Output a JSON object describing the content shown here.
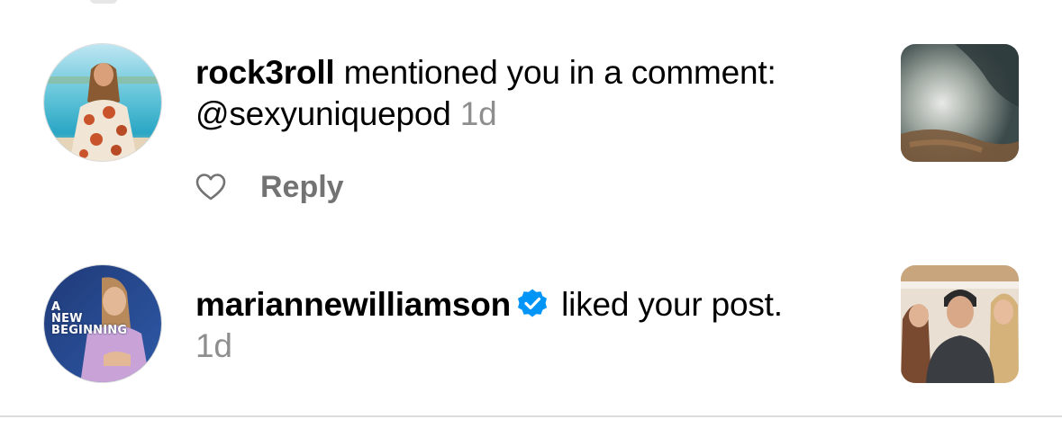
{
  "notifications": [
    {
      "username": "rock3roll",
      "text": " mentioned you in a comment: @sexyuniquepod",
      "time": "1d",
      "like_icon": "heart-outline-icon",
      "reply_label": "Reply"
    },
    {
      "username": "mariannewilliamson",
      "verified_icon": "verified-badge-icon",
      "text": " liked your post.",
      "time": "1d",
      "avatar_caption": [
        "A",
        "NEW",
        "BEGINNING"
      ]
    }
  ],
  "colors": {
    "text": "#000000",
    "secondary": "#8e8e8e",
    "reply": "#737373",
    "verified": "#0095f6",
    "divider": "#dbdbdb"
  }
}
